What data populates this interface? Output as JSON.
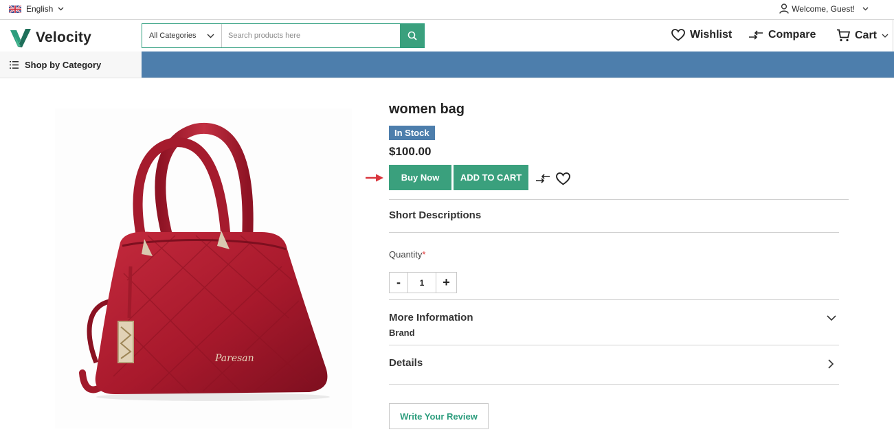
{
  "topbar": {
    "language": "English",
    "welcome": "Welcome, Guest!"
  },
  "header": {
    "logo": "Velocity",
    "category_select": "All Categories",
    "search_placeholder": "Search products here",
    "wishlist": "Wishlist",
    "compare": "Compare",
    "cart": "Cart"
  },
  "nav": {
    "shop_by_category": "Shop by Category"
  },
  "product": {
    "name": "women bag",
    "stock": "In Stock",
    "price": "$100.00",
    "buy_now": "Buy Now",
    "add_to_cart": "ADD TO CART",
    "short_descriptions": "Short Descriptions",
    "quantity_label": "Quantity",
    "quantity_required": "*",
    "quantity_minus": "-",
    "quantity_value": "1",
    "quantity_plus": "+",
    "more_information": "More Information",
    "brand_label": "Brand",
    "details": "Details",
    "write_review": "Write Your Review"
  },
  "colors": {
    "accent_green": "#3aa07d",
    "nav_blue": "#4d7eac",
    "bag_red": "#b01e31",
    "arrow_red": "#d9363e"
  },
  "icons": [
    "uk-flag-icon",
    "chevron-down-icon",
    "user-icon",
    "logo-v-icon",
    "search-icon",
    "heart-icon",
    "compare-icon",
    "cart-icon",
    "menu-list-icon",
    "arrow-right-icon",
    "chevron-right-icon"
  ]
}
